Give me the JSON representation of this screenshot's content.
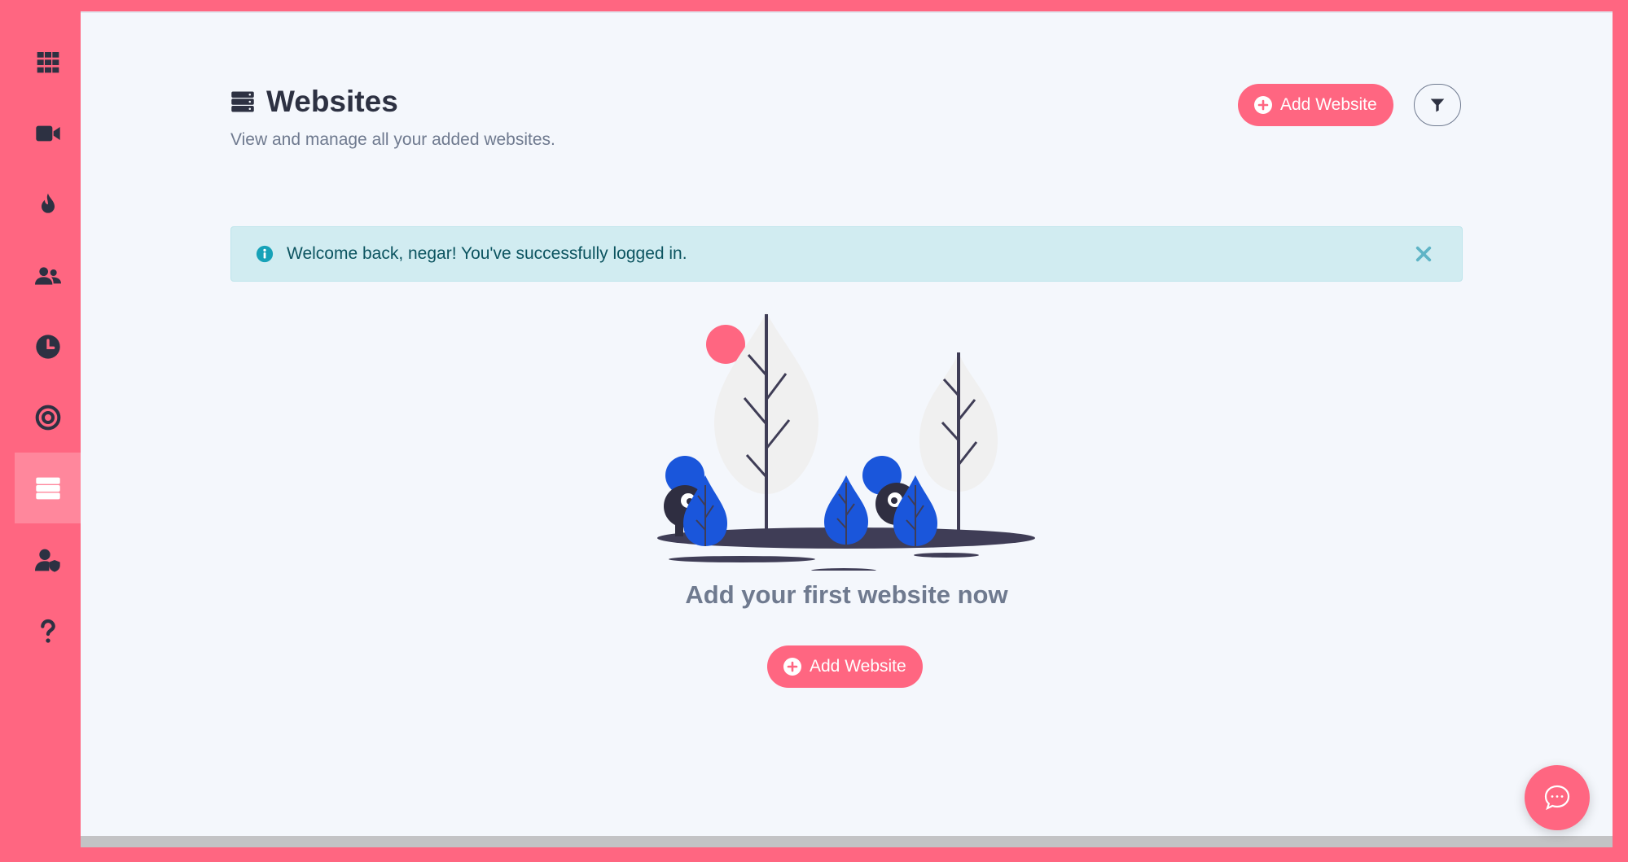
{
  "sidebar": {
    "items": [
      {
        "name": "apps-grid",
        "active": false
      },
      {
        "name": "video",
        "active": false
      },
      {
        "name": "fire",
        "active": false
      },
      {
        "name": "users",
        "active": false
      },
      {
        "name": "clock",
        "active": false
      },
      {
        "name": "target",
        "active": false
      },
      {
        "name": "websites",
        "active": true
      },
      {
        "name": "user-shield",
        "active": false
      },
      {
        "name": "help",
        "active": false
      }
    ]
  },
  "header": {
    "title": "Websites",
    "subtitle": "View and manage all your added websites.",
    "add_button_label": "Add Website",
    "filter_icon": "filter-icon"
  },
  "alert": {
    "message": "Welcome back, negar! You've successfully logged in.",
    "icon": "info-circle-icon",
    "close_icon": "close-icon"
  },
  "empty_state": {
    "title": "Add your first website now",
    "button_label": "Add Website"
  },
  "chat": {
    "icon": "chat-bubble-icon"
  },
  "colors": {
    "accent": "#ff6681",
    "dark": "#2d3142",
    "muted": "#6f7a8f",
    "alert_bg": "#d1ecf1",
    "alert_text": "#0c5460",
    "illustration_blue": "#1a56db"
  }
}
